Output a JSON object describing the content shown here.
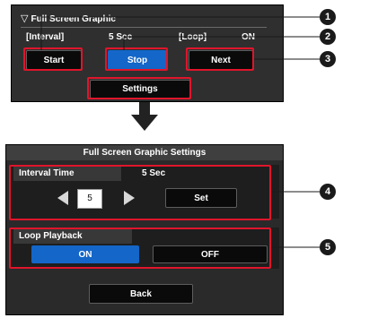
{
  "top": {
    "header": "Full Screen Graphic",
    "interval_label": "[Interval]",
    "interval_value": "5 Sec",
    "loop_label": "[Loop]",
    "loop_value": "ON",
    "buttons": {
      "start": "Start",
      "stop": "Stop",
      "next": "Next",
      "settings": "Settings"
    }
  },
  "settings": {
    "title": "Full Screen Graphic Settings",
    "interval_time_label": "Interval Time",
    "interval_time_value": "5 Sec",
    "interval_input": "5",
    "set_label": "Set",
    "loop_playback_label": "Loop Playback",
    "on_label": "ON",
    "off_label": "OFF",
    "back_label": "Back"
  },
  "callouts": [
    "1",
    "2",
    "3",
    "4",
    "5"
  ],
  "colors": {
    "highlight": "#e0152b",
    "selected": "#1466c8",
    "panel": "#2f2f2f"
  },
  "icons": [
    "triangle-down-icon",
    "arrow-down-icon",
    "arrow-left-icon",
    "arrow-right-icon"
  ]
}
